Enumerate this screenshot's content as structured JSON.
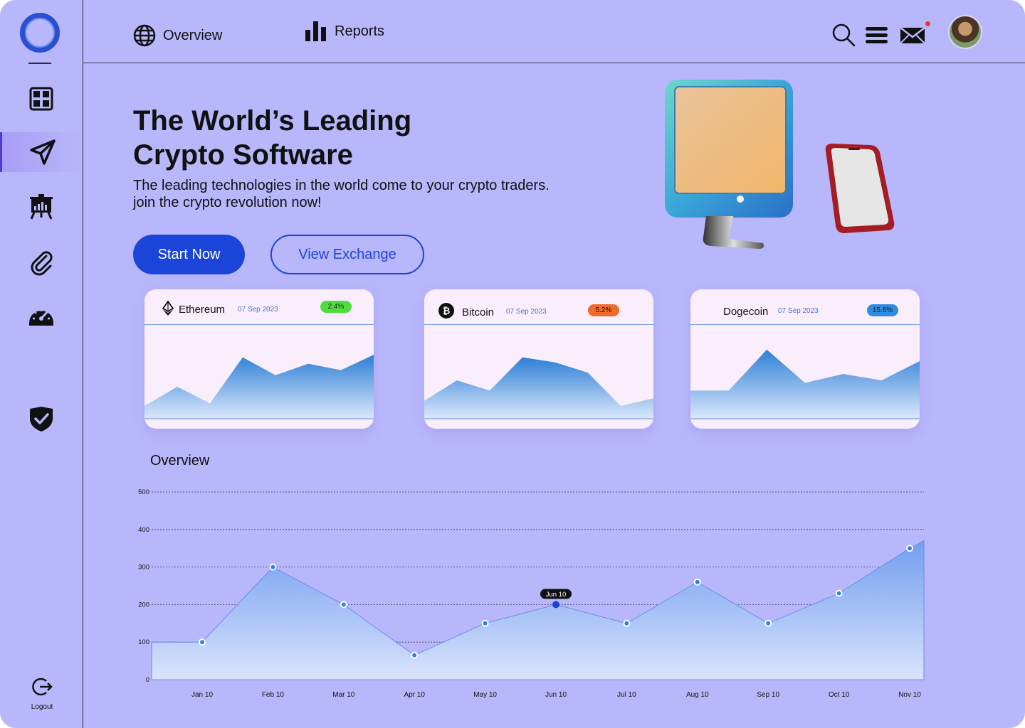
{
  "header": {
    "nav": [
      {
        "label": "Overview",
        "icon": "globe-icon"
      },
      {
        "label": "Reports",
        "icon": "bar-chart-icon"
      }
    ],
    "icons": [
      "search-icon",
      "menu-icon",
      "mail-icon"
    ],
    "has_notification": true
  },
  "sidebar": {
    "items": [
      {
        "icon": "dashboard-grid-icon",
        "active": false
      },
      {
        "icon": "send-icon",
        "active": true
      },
      {
        "icon": "presentation-chart-icon",
        "active": false
      },
      {
        "icon": "paperclip-icon",
        "active": false
      },
      {
        "icon": "speedometer-icon",
        "active": false
      },
      {
        "icon": "shield-check-icon",
        "active": false
      }
    ],
    "logout_label": "Logout"
  },
  "hero": {
    "title_line1": "The World’s Leading",
    "title_line2": "Crypto Software",
    "subtitle_line1": "The leading technologies in the world come to your crypto traders.",
    "subtitle_line2": "join the crypto revolution now!",
    "primary_button": "Start Now",
    "secondary_button": "View Exchange"
  },
  "coins": [
    {
      "name": "Ethereum",
      "date": "07 Sep 2023",
      "change": "2.4%",
      "badge_color": "#4fdc3c",
      "badge_text_color": "#0b3a08",
      "icon": "ethereum-icon",
      "spark": [
        10,
        25,
        12,
        48,
        34,
        43,
        38,
        50
      ]
    },
    {
      "name": "Bitcoin",
      "date": "07 Sep 2023",
      "change": "5.2%",
      "badge_color": "#f06a2a",
      "badge_text_color": "#2a0d00",
      "icon": "bitcoin-icon",
      "spark": [
        14,
        30,
        22,
        48,
        44,
        36,
        10,
        16
      ]
    },
    {
      "name": "Dogecoin",
      "date": "07 Sep 2023",
      "change": "15.6%",
      "badge_color": "#2f8be0",
      "badge_text_color": "#06213f",
      "icon": "",
      "spark": [
        22,
        22,
        54,
        28,
        35,
        30,
        45
      ]
    }
  ],
  "overview": {
    "title": "Overview"
  },
  "chart_data": {
    "type": "area",
    "x": [
      "Jan 10",
      "Feb 10",
      "Mar 10",
      "Apr 10",
      "May 10",
      "Jun 10",
      "Jul 10",
      "Aug 10",
      "Sep 10",
      "Oct 10",
      "Nov 10"
    ],
    "values": [
      100,
      300,
      200,
      65,
      150,
      200,
      150,
      260,
      150,
      230,
      350
    ],
    "start_value": 100,
    "end_value": 370,
    "yticks": [
      0,
      100,
      200,
      300,
      400,
      500
    ],
    "ylim": [
      0,
      500
    ],
    "grid": true,
    "highlight": {
      "index": 5,
      "label": "Jun 10"
    },
    "fill_color": "#6f9df0",
    "line_color": "#6a8ee8"
  },
  "colors": {
    "background": "#b9b7fb",
    "primary": "#1a45d8",
    "card": "#fbeefc"
  }
}
